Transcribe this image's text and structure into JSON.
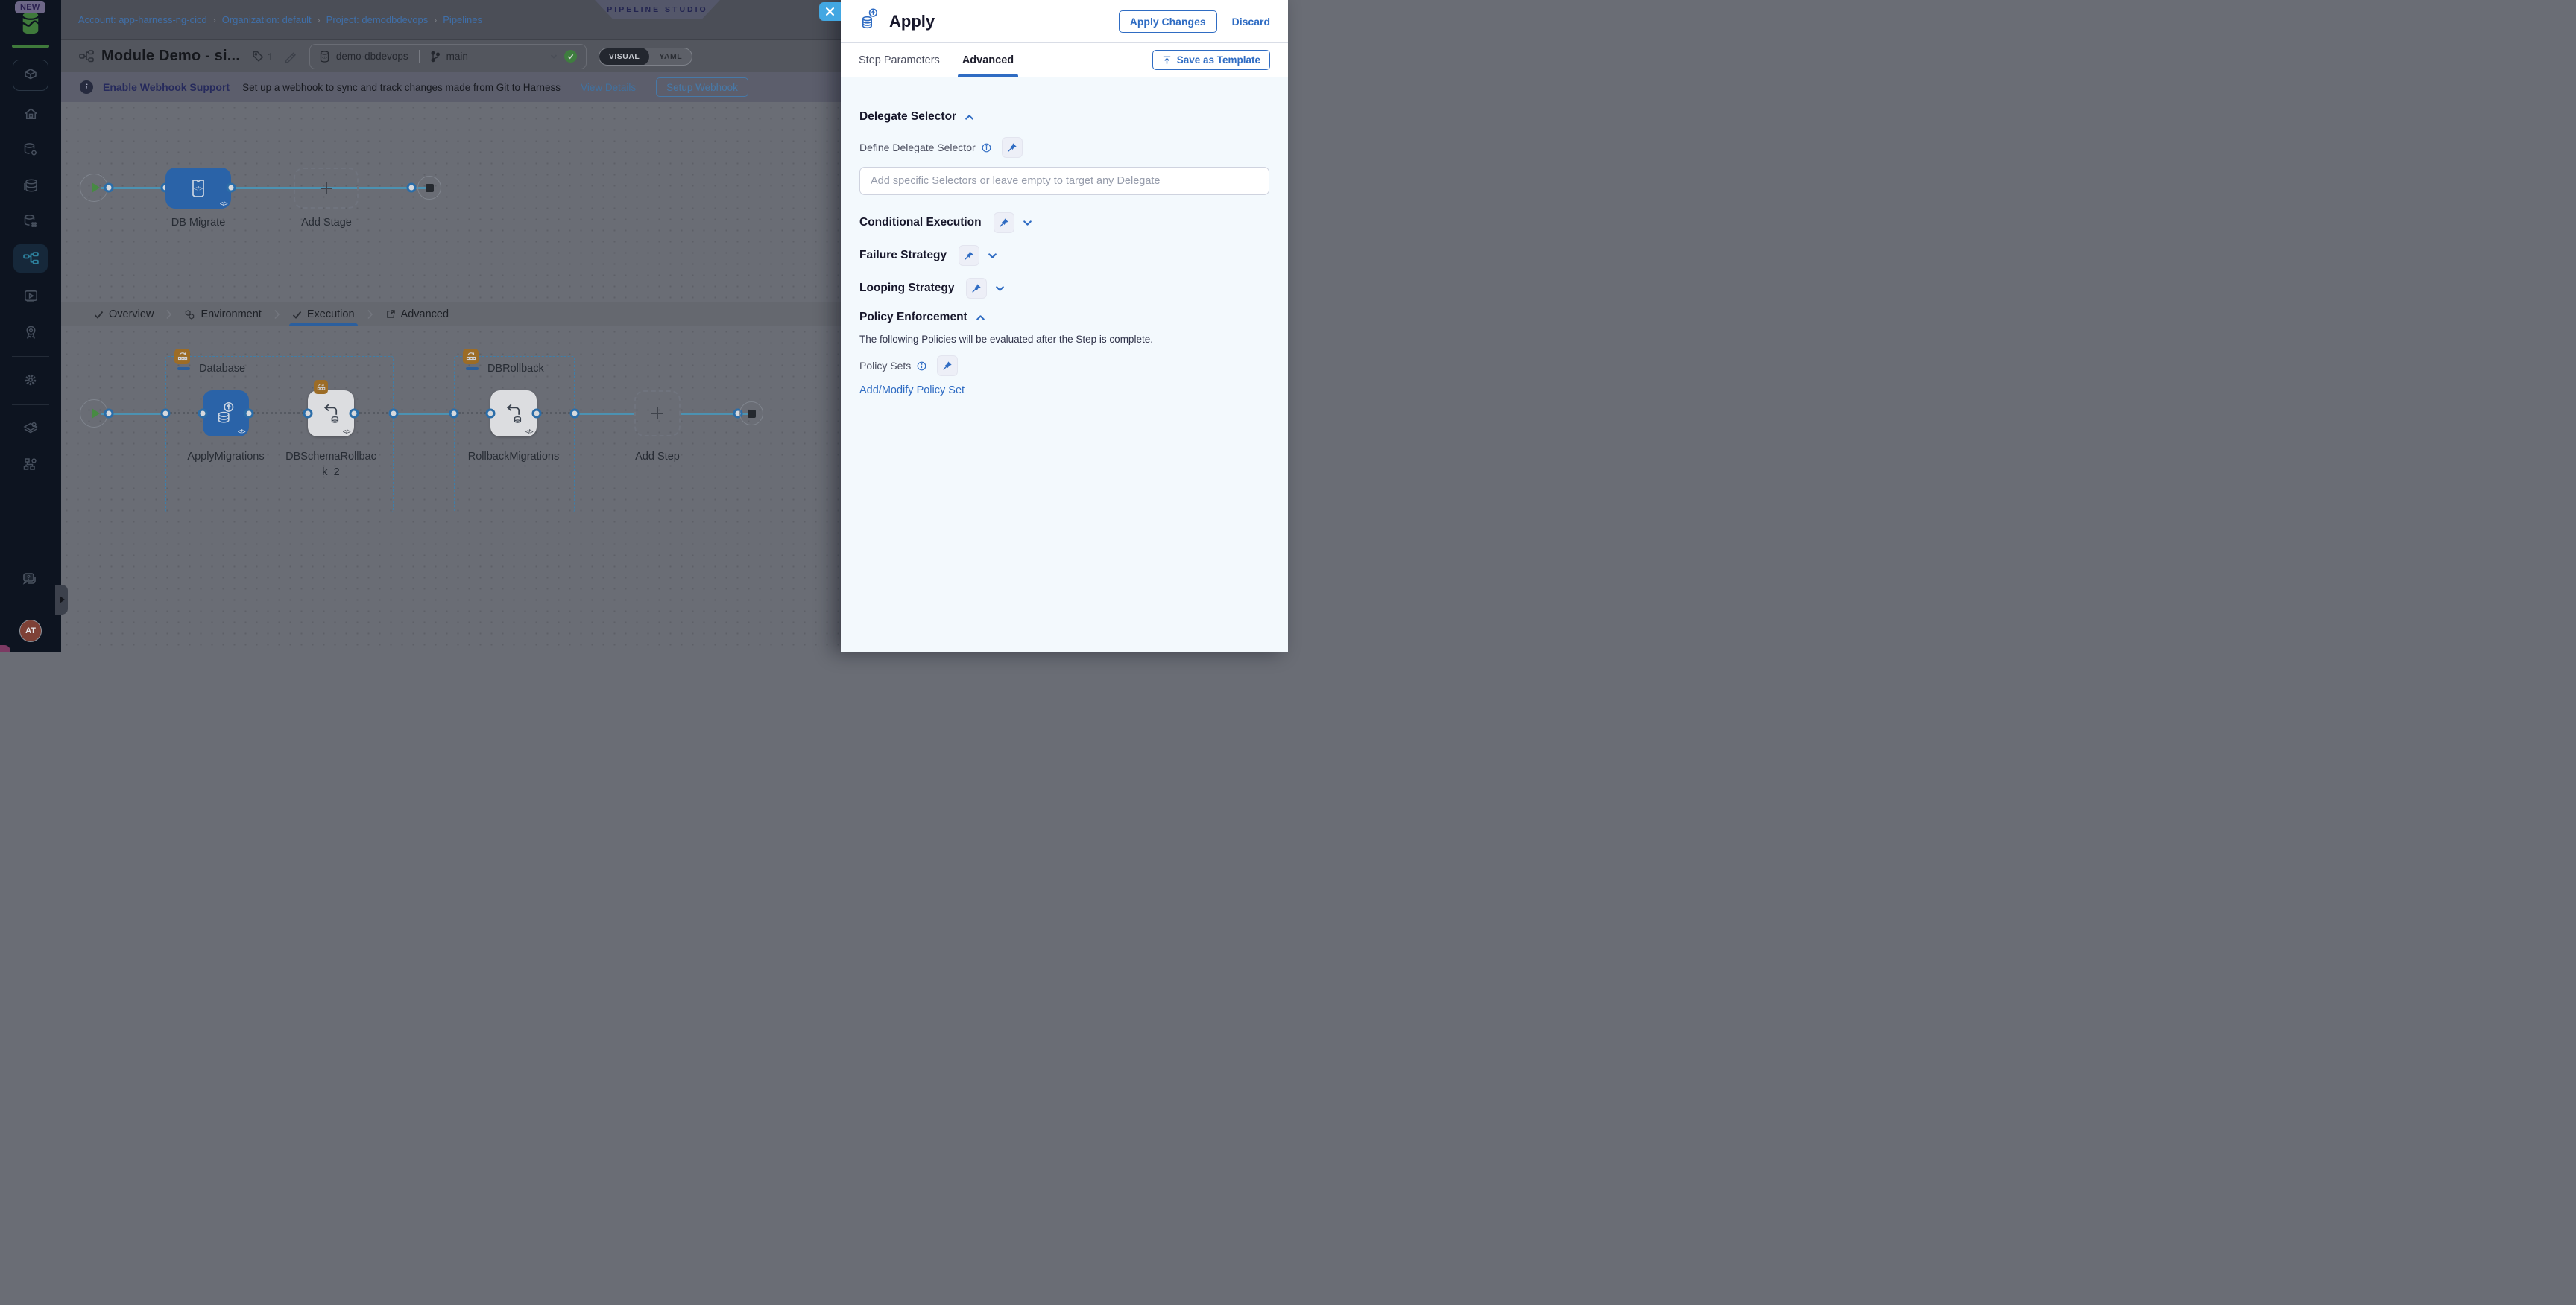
{
  "sidebar": {
    "new_badge": "NEW",
    "avatar_initials": "AT",
    "icons": [
      "harness-dbdevops-logo",
      "module-switcher",
      "home",
      "db-configuration",
      "db-instances",
      "db-schemas",
      "pipelines",
      "executions",
      "certificates",
      "settings",
      "project-setup",
      "org-setup",
      "help-chat"
    ]
  },
  "breadcrumb": {
    "items": [
      "Account: app-harness-ng-cicd",
      "Organization: default",
      "Project: demodbdevops",
      "Pipelines"
    ]
  },
  "studio_badge": "PIPELINE STUDIO",
  "pipeline_header": {
    "title": "Module Demo - si...",
    "tag_count": "1",
    "repo": "demo-dbdevops",
    "branch": "main",
    "toggle": {
      "visual": "VISUAL",
      "yaml": "YAML",
      "selected": "VISUAL"
    }
  },
  "webhook_banner": {
    "title": "Enable Webhook Support",
    "message": "Set up a webhook to sync and track changes made from Git to Harness",
    "view_details": "View Details",
    "setup_button": "Setup Webhook"
  },
  "stage_graph": {
    "stage_label": "DB Migrate",
    "add_stage_label": "Add Stage"
  },
  "stage_tabs": {
    "overview": "Overview",
    "environment": "Environment",
    "execution": "Execution",
    "advanced": "Advanced",
    "active": "Execution"
  },
  "execution_graph": {
    "groups": [
      {
        "name": "Database",
        "steps": [
          "ApplyMigrations",
          "DBSchemaRollback_2"
        ]
      },
      {
        "name": "DBRollback",
        "steps": [
          "RollbackMigrations"
        ]
      }
    ],
    "add_step_label": "Add Step"
  },
  "drawer": {
    "title": "Apply",
    "apply_changes": "Apply Changes",
    "discard": "Discard",
    "tabs": {
      "step_parameters": "Step Parameters",
      "advanced": "Advanced",
      "active": "Advanced"
    },
    "save_as_template": "Save as Template",
    "delegate": {
      "section": "Delegate Selector",
      "label": "Define Delegate Selector",
      "placeholder": "Add specific Selectors or leave empty to target any Delegate",
      "value": ""
    },
    "conditional_execution": "Conditional Execution",
    "failure_strategy": "Failure Strategy",
    "looping_strategy": "Looping Strategy",
    "policy": {
      "section": "Policy Enforcement",
      "description": "The following Policies will be evaluated after the Step is complete.",
      "policy_sets_label": "Policy Sets",
      "add_link": "Add/Modify Policy Set"
    }
  },
  "colors": {
    "primary_blue": "#2f6cc3",
    "close_button_blue": "#42a7e2",
    "stage_node_blue": "#2a63a8",
    "connector_teal": "#4c92b2",
    "success_green": "#3f7d3f",
    "step_group_badge_orange": "#9c6c26",
    "banner_purple": "#5c5e6c",
    "sidebar_navy": "#0d1420",
    "logo_green": "#3f7a3b"
  }
}
